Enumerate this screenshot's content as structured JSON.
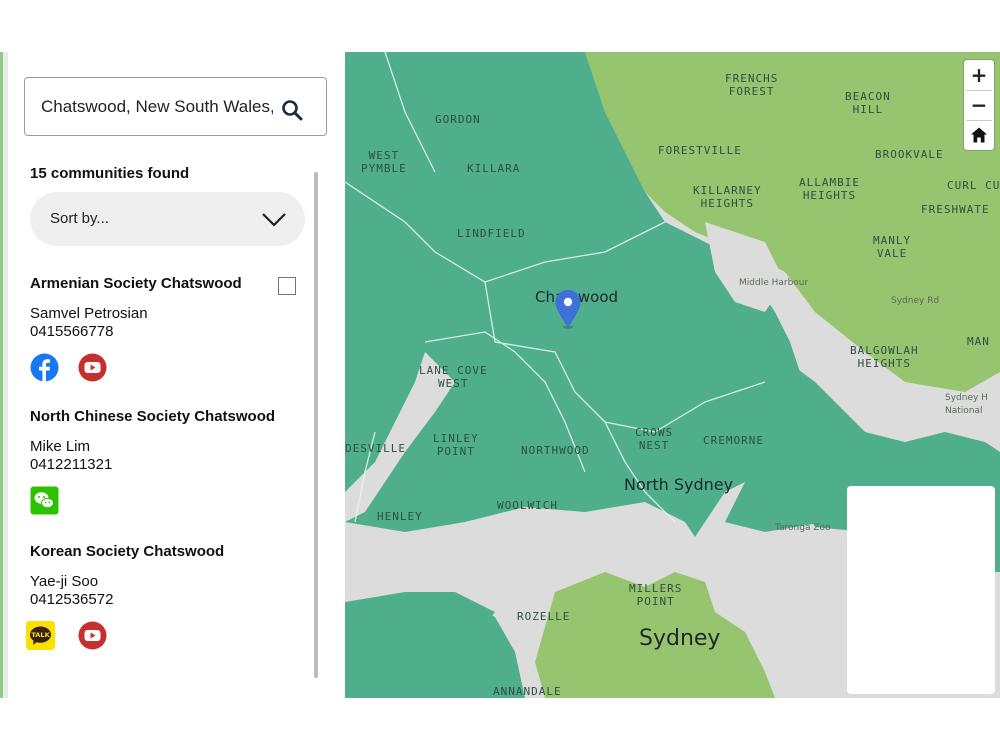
{
  "search": {
    "value": "Chatswood, New South Wales, Australia",
    "icon": "search-icon"
  },
  "results": {
    "count_text": "15 communities found"
  },
  "sort": {
    "label": "Sort by..."
  },
  "communities": [
    {
      "name": "Armenian Society Chatswood",
      "contact": "Samvel Petrosian",
      "phone": "0415566778",
      "socials": [
        "facebook-icon",
        "youtube-icon"
      ]
    },
    {
      "name": "North Chinese Society Chatswood",
      "contact": "Mike Lim",
      "phone": "0412211321",
      "socials": [
        "wechat-icon"
      ]
    },
    {
      "name": "Korean Society Chatswood",
      "contact": "Yae-ji Soo",
      "phone": "0412536572",
      "socials": [
        "kakaotalk-icon",
        "youtube-icon"
      ]
    }
  ],
  "social_colors": {
    "facebook": "#1877f2",
    "youtube": "#c4302b",
    "wechat": "#2dc100",
    "kakaotalk": "#fae100"
  },
  "kakao_badge_text": "TALK",
  "map": {
    "zoom_in": "+",
    "zoom_out": "−",
    "home_icon": "home-icon",
    "colors": {
      "teal": "#4fae8c",
      "green": "#97c46f",
      "gray": "#dcdcdc"
    },
    "labels": {
      "frenchs_forest": "FRENCHS\nFOREST",
      "beacon_hill": "BEACON\nHILL",
      "gordon": "GORDON",
      "west_pymble": "WEST\nPYMBLE",
      "killara": "KILLARA",
      "forestville": "FORESTVILLE",
      "brookvale": "BROOKVALE",
      "killarney_heights": "KILLARNEY\nHEIGHTS",
      "allambie_heights": "ALLAMBIE\nHEIGHTS",
      "curl_curl": "CURL CU",
      "freshwater": "FRESHWATE",
      "lindfield": "LINDFIELD",
      "manly_vale": "MANLY\nVALE",
      "chatswood": "Chatswood",
      "lane_cove_west": "LANE COVE\nWEST",
      "balgowlah_heights": "BALGOWLAH\nHEIGHTS",
      "manly_partial": "MAN",
      "desville_partial": "DESVILLE",
      "linley_point": "LINLEY\nPOINT",
      "crows_nest": "CROWS\nNEST",
      "cremorne": "CREMORNE",
      "northwood": "NORTHWOOD",
      "north_sydney": "North Sydney",
      "henley": "HENLEY",
      "woolwich": "WOOLWICH",
      "millers_point": "MILLERS\nPOINT",
      "rozelle": "ROZELLE",
      "sydney": "Sydney",
      "annandale": "ANNANDALE",
      "taronga_zoo": "Taronga Zoo",
      "middle_harbour": "Middle Harbour",
      "sydney_rd": "Sydney Rd",
      "sydney_national": "Sydney H\nNational"
    }
  }
}
